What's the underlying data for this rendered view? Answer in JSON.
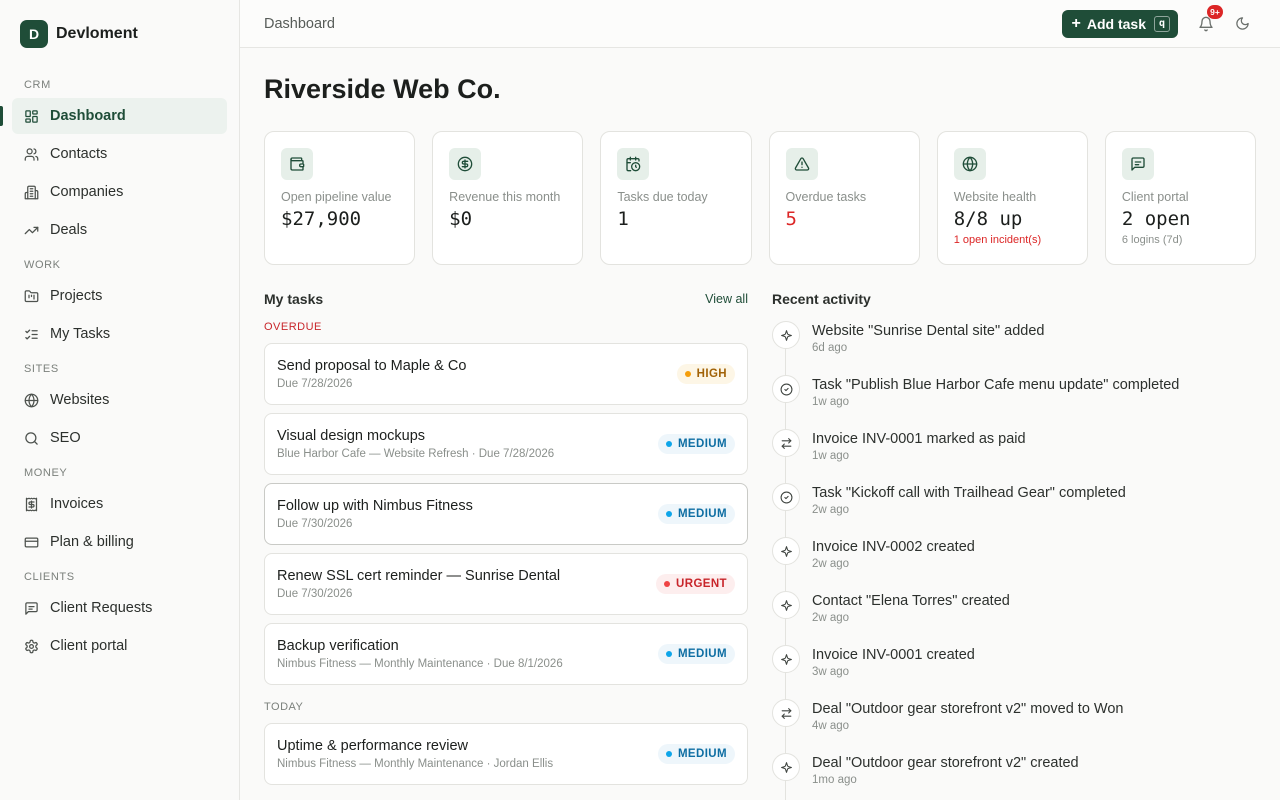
{
  "brand": {
    "logo_letter": "D",
    "name": "Devloment"
  },
  "sidebar": {
    "sections": [
      {
        "title": "CRM",
        "items": [
          {
            "label": "Dashboard",
            "icon": "dashboard-icon"
          },
          {
            "label": "Contacts",
            "icon": "users-icon"
          },
          {
            "label": "Companies",
            "icon": "building-icon"
          },
          {
            "label": "Deals",
            "icon": "trending-up-icon"
          }
        ]
      },
      {
        "title": "WORK",
        "items": [
          {
            "label": "Projects",
            "icon": "folder-kanban-icon"
          },
          {
            "label": "My Tasks",
            "icon": "list-checks-icon"
          }
        ]
      },
      {
        "title": "SITES",
        "items": [
          {
            "label": "Websites",
            "icon": "globe-icon"
          },
          {
            "label": "SEO",
            "icon": "search-icon"
          }
        ]
      },
      {
        "title": "MONEY",
        "items": [
          {
            "label": "Invoices",
            "icon": "receipt-icon"
          },
          {
            "label": "Plan & billing",
            "icon": "credit-card-icon"
          }
        ]
      },
      {
        "title": "CLIENTS",
        "items": [
          {
            "label": "Client Requests",
            "icon": "message-square-icon"
          },
          {
            "label": "Client portal",
            "icon": "settings-icon"
          }
        ]
      }
    ],
    "active": "Dashboard"
  },
  "topbar": {
    "breadcrumb": "Dashboard",
    "add_task_label": "Add task",
    "add_task_shortcut": "q",
    "notification_count": "9+"
  },
  "page": {
    "title": "Riverside Web Co."
  },
  "stats": [
    {
      "label": "Open pipeline value",
      "value": "$27,900",
      "sub": "",
      "icon": "wallet-icon",
      "value_color": "#1c1f1d"
    },
    {
      "label": "Revenue this month",
      "value": "$0",
      "sub": "",
      "icon": "dollar-circle-icon",
      "value_color": "#1c1f1d"
    },
    {
      "label": "Tasks due today",
      "value": "1",
      "sub": "",
      "icon": "calendar-clock-icon",
      "value_color": "#1c1f1d"
    },
    {
      "label": "Overdue tasks",
      "value": "5",
      "sub": "",
      "icon": "alert-triangle-icon",
      "value_color": "#dc2626"
    },
    {
      "label": "Website health",
      "value": "8/8 up",
      "sub": "1 open incident(s)",
      "icon": "globe-icon",
      "sub_color": "#dc2626"
    },
    {
      "label": "Client portal",
      "value": "2 open",
      "sub": "6 logins (7d)",
      "icon": "message-square-icon"
    }
  ],
  "tasks": {
    "title": "My tasks",
    "view_all": "View all",
    "groups": [
      {
        "label": "OVERDUE",
        "items": [
          {
            "title": "Send proposal to Maple & Co",
            "meta": "Due 7/28/2026",
            "priority": "HIGH"
          },
          {
            "title": "Visual design mockups",
            "meta": "Blue Harbor Cafe — Website Refresh · Due 7/28/2026",
            "priority": "MEDIUM"
          },
          {
            "title": "Follow up with Nimbus Fitness",
            "meta": "Due 7/30/2026",
            "priority": "MEDIUM"
          },
          {
            "title": "Renew SSL cert reminder — Sunrise Dental",
            "meta": "Due 7/30/2026",
            "priority": "URGENT"
          },
          {
            "title": "Backup verification",
            "meta": "Nimbus Fitness — Monthly Maintenance · Due 8/1/2026",
            "priority": "MEDIUM"
          }
        ]
      },
      {
        "label": "TODAY",
        "items": [
          {
            "title": "Uptime & performance review",
            "meta": "Nimbus Fitness — Monthly Maintenance · Jordan Ellis",
            "priority": "MEDIUM"
          }
        ]
      }
    ]
  },
  "activity": {
    "title": "Recent activity",
    "items": [
      {
        "text": "Website \"Sunrise Dental site\" added",
        "time": "6d ago",
        "icon": "sparkles-icon"
      },
      {
        "text": "Task \"Publish Blue Harbor Cafe menu update\" completed",
        "time": "1w ago",
        "icon": "check-circle-icon"
      },
      {
        "text": "Invoice INV-0001 marked as paid",
        "time": "1w ago",
        "icon": "arrows-swap-icon"
      },
      {
        "text": "Task \"Kickoff call with Trailhead Gear\" completed",
        "time": "2w ago",
        "icon": "check-circle-icon"
      },
      {
        "text": "Invoice INV-0002 created",
        "time": "2w ago",
        "icon": "sparkles-icon"
      },
      {
        "text": "Contact \"Elena Torres\" created",
        "time": "2w ago",
        "icon": "sparkles-icon"
      },
      {
        "text": "Invoice INV-0001 created",
        "time": "3w ago",
        "icon": "sparkles-icon"
      },
      {
        "text": "Deal \"Outdoor gear storefront v2\" moved to Won",
        "time": "4w ago",
        "icon": "arrows-swap-icon"
      },
      {
        "text": "Deal \"Outdoor gear storefront v2\" created",
        "time": "1mo ago",
        "icon": "sparkles-icon"
      }
    ]
  },
  "colors": {
    "accent": "#1f4d38",
    "danger": "#dc2626",
    "high": "#f59e0b",
    "medium": "#0ea5e9"
  }
}
